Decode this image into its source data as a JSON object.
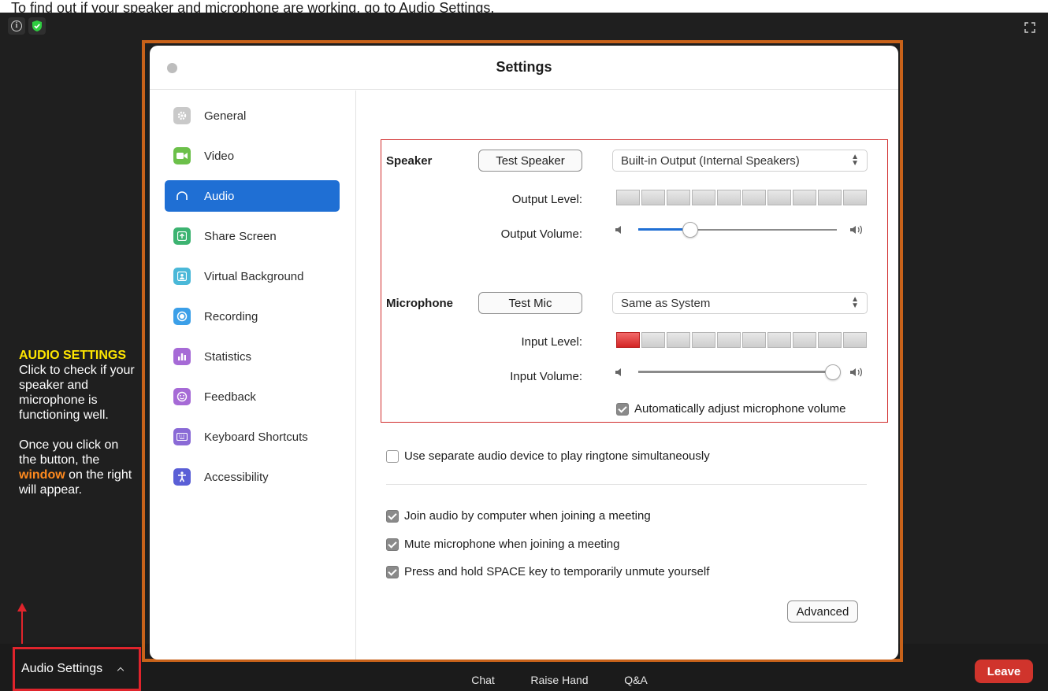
{
  "caption": "To find out if your speaker and microphone are working, go to Audio Settings.",
  "annotation": {
    "heading": "AUDIO SETTINGS",
    "body1": "Click to check if your speaker and microphone is functioning well.",
    "body2_pre": "Once you click on the button, the ",
    "body2_highlight": "window",
    "body2_post": " on the right will appear."
  },
  "dialog": {
    "title": "Settings",
    "sidebar": [
      {
        "label": "General",
        "icon": "gear-icon",
        "color": "#c9c9c9"
      },
      {
        "label": "Video",
        "icon": "video-camera-icon",
        "color": "#6cc04a"
      },
      {
        "label": "Audio",
        "icon": "headphones-icon",
        "color": "#1f6fd4",
        "active": true
      },
      {
        "label": "Share Screen",
        "icon": "share-screen-icon",
        "color": "#3cb371"
      },
      {
        "label": "Virtual Background",
        "icon": "person-icon",
        "color": "#4ab8d8"
      },
      {
        "label": "Recording",
        "icon": "record-icon",
        "color": "#3b9fe8"
      },
      {
        "label": "Statistics",
        "icon": "bar-chart-icon",
        "color": "#a66ad6"
      },
      {
        "label": "Feedback",
        "icon": "smiley-icon",
        "color": "#a66ad6"
      },
      {
        "label": "Keyboard Shortcuts",
        "icon": "keyboard-icon",
        "color": "#8a6ad6"
      },
      {
        "label": "Accessibility",
        "icon": "accessibility-icon",
        "color": "#5a5fd6"
      }
    ],
    "speaker": {
      "label": "Speaker",
      "test_button": "Test Speaker",
      "device": "Built-in Output (Internal Speakers)",
      "output_level_label": "Output Level:",
      "output_level": 0,
      "output_volume_label": "Output Volume:",
      "output_volume": 0.26
    },
    "microphone": {
      "label": "Microphone",
      "test_button": "Test Mic",
      "device": "Same as System",
      "input_level_label": "Input Level:",
      "input_level": 1,
      "input_volume_label": "Input Volume:",
      "input_volume": 0.98,
      "auto_adjust_label": "Automatically adjust microphone volume",
      "auto_adjust": true
    },
    "options": [
      {
        "label": "Use separate audio device to play ringtone simultaneously",
        "checked": false
      },
      {
        "label": "Join audio by computer when joining a meeting",
        "checked": true
      },
      {
        "label": "Mute microphone when joining a meeting",
        "checked": true
      },
      {
        "label": "Press and hold SPACE key to temporarily unmute yourself",
        "checked": true
      }
    ],
    "advanced_button": "Advanced"
  },
  "bottom_bar": {
    "audio_settings": "Audio Settings",
    "chat": "Chat",
    "raise_hand": "Raise Hand",
    "qa": "Q&A",
    "leave": "Leave"
  },
  "colors": {
    "accent": "#1f6fd4",
    "annotation_highlight": "#ffe600",
    "annotation_emphasis": "#ff8a1e",
    "frame": "#c8621a",
    "callout": "#e0242c",
    "leave": "#d0342c"
  }
}
